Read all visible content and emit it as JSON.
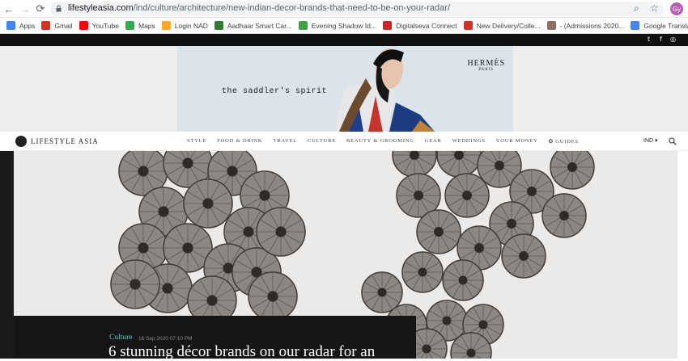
{
  "browser": {
    "url_host": "lifestyleasia.com",
    "url_path": "/ind/culture/architecture/new-indian-decor-brands-that-need-to-be-on-your-radar/",
    "avatar": "Gy"
  },
  "bookmarks": [
    {
      "label": "Apps",
      "icon": "apps-icon",
      "color": "#4285f4"
    },
    {
      "label": "Gmail",
      "icon": "gmail-icon",
      "color": "#d93025"
    },
    {
      "label": "YouTube",
      "icon": "youtube-icon",
      "color": "#ff0000"
    },
    {
      "label": "Maps",
      "icon": "maps-icon",
      "color": "#34a853"
    },
    {
      "label": "Login NAD",
      "icon": "nad-icon",
      "color": "#f9a825"
    },
    {
      "label": "Aadhaar Smart Car...",
      "icon": "aadhaar-icon",
      "color": "#2e7d32"
    },
    {
      "label": "Evening Shadow Id...",
      "icon": "evening-shadow-icon",
      "color": "#43a047"
    },
    {
      "label": "Digitalseva Connect",
      "icon": "digitalseva-icon",
      "color": "#c62828"
    },
    {
      "label": "New Delivery/Colle...",
      "icon": "gmail-icon",
      "color": "#d93025"
    },
    {
      "label": "- (Admissions 2020...",
      "icon": "admissions-icon",
      "color": "#8d6e63"
    },
    {
      "label": "Google Translate",
      "icon": "translate-icon",
      "color": "#4285f4"
    }
  ],
  "social": {
    "twitter": "t",
    "facebook": "f",
    "instagram": "◎"
  },
  "ad": {
    "tagline": "the saddler's spirit",
    "brand": "HERMÈS",
    "brand_sub": "PARIS"
  },
  "site": {
    "logo": "LIFESTYLE ASIA",
    "menu": [
      "STYLE",
      "FOOD & DRINK",
      "TRAVEL",
      "CULTURE",
      "BEAUTY & GROOMING",
      "GEAR",
      "WEDDINGS",
      "YOUR MONEY",
      "✪ GUIDES"
    ],
    "region": "IND ▾"
  },
  "article": {
    "category": "Culture",
    "date": "16 Sep 2020 07:10 PM",
    "headline": "6 stunning décor brands on our radar for an"
  }
}
